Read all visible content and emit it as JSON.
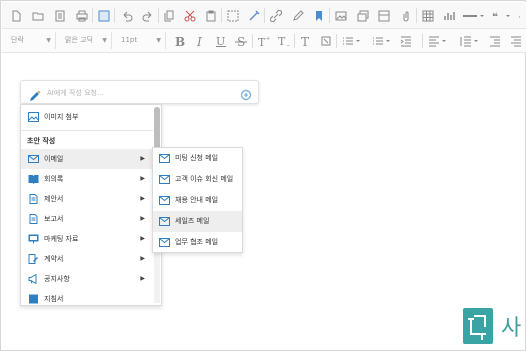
{
  "toolbar2": {
    "paragraph_style": "단락",
    "font_family": "맑은 고딕",
    "font_size": "11pt"
  },
  "ai_prompt": {
    "placeholder": "AI에게 작성 요청..."
  },
  "menu": {
    "attach_image": "이미지 첨부",
    "section_draft": "초안 작성",
    "items": [
      {
        "label": "이메일",
        "icon": "mail-icon"
      },
      {
        "label": "회의록",
        "icon": "book-icon"
      },
      {
        "label": "제안서",
        "icon": "document-icon"
      },
      {
        "label": "보고서",
        "icon": "document-icon"
      },
      {
        "label": "마케팅 자료",
        "icon": "presentation-icon"
      },
      {
        "label": "계약서",
        "icon": "contract-icon"
      },
      {
        "label": "공지사항",
        "icon": "megaphone-icon"
      },
      {
        "label": "지침서",
        "icon": "guide-icon"
      }
    ]
  },
  "submenu": {
    "items": [
      {
        "label": "미팅 신청 메일"
      },
      {
        "label": "고객 이슈 회신 메일"
      },
      {
        "label": "채용 안내 메일"
      },
      {
        "label": "세일즈 메일"
      },
      {
        "label": "업무 협조 메일"
      }
    ]
  },
  "watermark": {
    "text": "사",
    "color": "#3aa3a3"
  },
  "colors": {
    "accent_icon": "#2f7fc0",
    "highlight": "#eeeeee"
  }
}
